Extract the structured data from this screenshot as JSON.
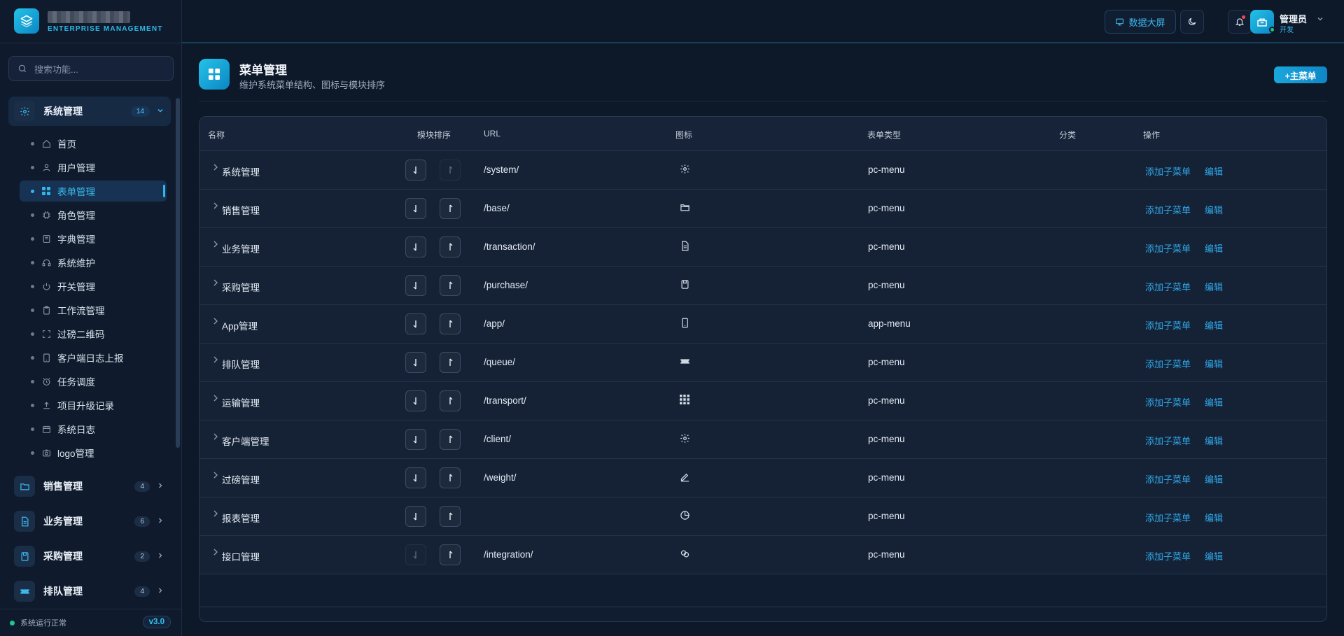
{
  "brand": {
    "subtitle": "ENTERPRISE MANAGEMENT"
  },
  "search": {
    "placeholder": "搜索功能..."
  },
  "sidebar": {
    "groups": [
      {
        "label": "系统管理",
        "count": "14",
        "icon": "gear-icon",
        "expanded": true
      },
      {
        "label": "销售管理",
        "count": "4",
        "icon": "folder-icon"
      },
      {
        "label": "业务管理",
        "count": "6",
        "icon": "document-icon"
      },
      {
        "label": "采购管理",
        "count": "2",
        "icon": "save-icon"
      },
      {
        "label": "排队管理",
        "count": "4",
        "icon": "ticket-icon"
      }
    ],
    "subitems": [
      {
        "label": "首页",
        "icon": "home-icon"
      },
      {
        "label": "用户管理",
        "icon": "user-icon"
      },
      {
        "label": "表单管理",
        "icon": "grid-icon",
        "active": true
      },
      {
        "label": "角色管理",
        "icon": "chip-icon"
      },
      {
        "label": "字典管理",
        "icon": "book-icon"
      },
      {
        "label": "系统维护",
        "icon": "headset-icon"
      },
      {
        "label": "开关管理",
        "icon": "power-icon"
      },
      {
        "label": "工作流管理",
        "icon": "clipboard-icon"
      },
      {
        "label": "过磅二维码",
        "icon": "scan-icon"
      },
      {
        "label": "客户端日志上报",
        "icon": "tablet-icon"
      },
      {
        "label": "任务调度",
        "icon": "alarm-icon"
      },
      {
        "label": "项目升级记录",
        "icon": "upload-icon"
      },
      {
        "label": "系统日志",
        "icon": "calendar-icon"
      },
      {
        "label": "logo管理",
        "icon": "camera-icon"
      }
    ],
    "footer": {
      "status": "系统运行正常",
      "version": "v3.0"
    }
  },
  "topbar": {
    "dashboard_label": "数据大屏",
    "user_name": "管理员",
    "user_role": "开发"
  },
  "page": {
    "title": "菜单管理",
    "subtitle": "维护系统菜单结构、图标与模块排序",
    "add_button": "+主菜单"
  },
  "table": {
    "headers": {
      "name": "名称",
      "sort": "模块排序",
      "url": "URL",
      "icon": "图标",
      "type": "表单类型",
      "category": "分类",
      "actions": "操作"
    },
    "action_add": "添加子菜单",
    "action_edit": "编辑",
    "rows": [
      {
        "name": "系统管理",
        "url": "/system/",
        "icon": "gear-icon",
        "type": "pc-menu",
        "up_disabled": true,
        "down_disabled": false
      },
      {
        "name": "销售管理",
        "url": "/base/",
        "icon": "folder-icon",
        "type": "pc-menu"
      },
      {
        "name": "业务管理",
        "url": "/transaction/",
        "icon": "document-icon",
        "type": "pc-menu"
      },
      {
        "name": "采购管理",
        "url": "/purchase/",
        "icon": "save-icon",
        "type": "pc-menu"
      },
      {
        "name": "App管理",
        "url": "/app/",
        "icon": "mobile-icon",
        "type": "app-menu"
      },
      {
        "name": "排队管理",
        "url": "/queue/",
        "icon": "ticket-icon",
        "type": "pc-menu"
      },
      {
        "name": "运输管理",
        "url": "/transport/",
        "icon": "apps-grid-icon",
        "type": "pc-menu"
      },
      {
        "name": "客户端管理",
        "url": "/client/",
        "icon": "gear-icon",
        "type": "pc-menu"
      },
      {
        "name": "过磅管理",
        "url": "/weight/",
        "icon": "pen-icon",
        "type": "pc-menu"
      },
      {
        "name": "报表管理",
        "url": "",
        "icon": "pie-chart-icon",
        "type": "pc-menu"
      },
      {
        "name": "接口管理",
        "url": "/integration/",
        "icon": "link-icon",
        "type": "pc-menu",
        "up_disabled": false,
        "down_disabled": true
      }
    ]
  },
  "colors": {
    "accent": "#2fb8ee",
    "link": "#2fa7e8",
    "background": "#0d1828",
    "status_ok": "#22c58b"
  }
}
